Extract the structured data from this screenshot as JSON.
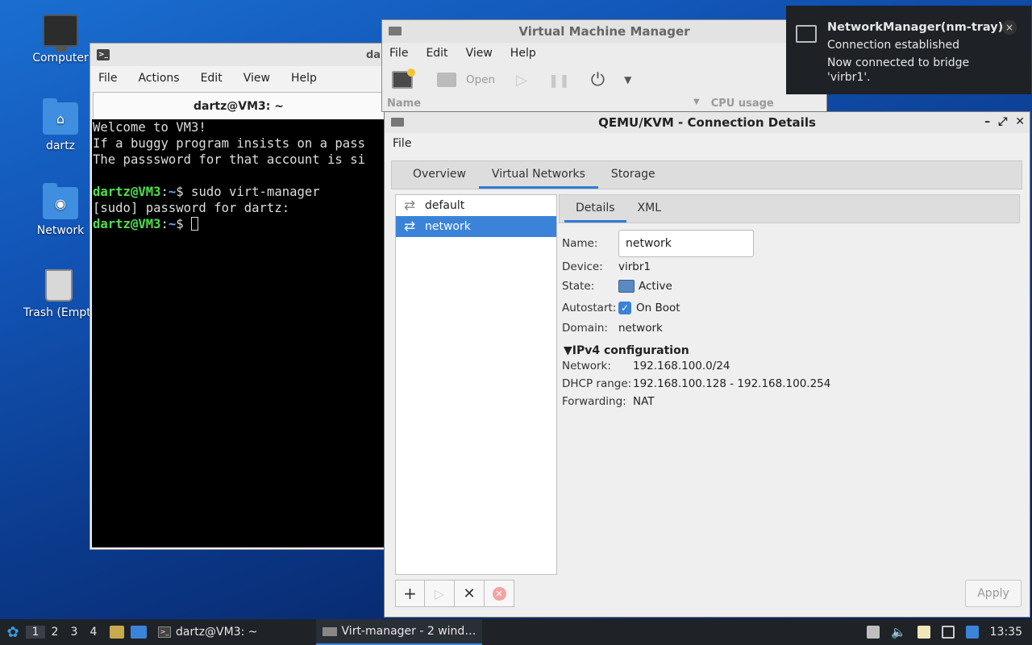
{
  "desktop": {
    "icons": [
      {
        "label": "Computer",
        "icon": "computer-icon"
      },
      {
        "label": "dartz",
        "icon": "home-folder-icon"
      },
      {
        "label": "Network",
        "icon": "network-folder-icon"
      },
      {
        "label": "Trash (Empt",
        "icon": "trash-icon"
      }
    ]
  },
  "terminal": {
    "title_partial": "da",
    "menu": [
      "File",
      "Actions",
      "Edit",
      "View",
      "Help"
    ],
    "tab_title": "dartz@VM3: ~",
    "lines": [
      "Welcome to VM3!",
      "If a buggy program insists on a pass",
      "The passsword for that account is si",
      ""
    ],
    "prompt_user": "dartz@VM3",
    "prompt_sep": ":",
    "prompt_path": "~",
    "prompt_symbol": "$",
    "command": " sudo virt-manager",
    "sudo_line": "[sudo] password for dartz:"
  },
  "vmm": {
    "title": "Virtual Machine Manager",
    "menu": [
      "File",
      "Edit",
      "View",
      "Help"
    ],
    "toolbar": {
      "open": "Open"
    },
    "columns": {
      "name": "Name",
      "cpu": "CPU usage"
    }
  },
  "notification": {
    "title": "NetworkManager(nm-tray)",
    "line1": "Connection established",
    "line2": "Now connected to bridge",
    "line3": "'virbr1'.",
    "close": "×"
  },
  "qemu": {
    "title": "QEMU/KVM - Connection Details",
    "menu_file": "File",
    "tabs": [
      "Overview",
      "Virtual Networks",
      "Storage"
    ],
    "networks": [
      "default",
      "network"
    ],
    "inner_tabs": [
      "Details",
      "XML"
    ],
    "details": {
      "name_label": "Name:",
      "name_value": "network",
      "device_label": "Device:",
      "device_value": "virbr1",
      "state_label": "State:",
      "state_value": "Active",
      "autostart_label": "Autostart:",
      "autostart_value": "On Boot",
      "domain_label": "Domain:",
      "domain_value": "network"
    },
    "ipv4": {
      "title": "IPv4 configuration",
      "network_label": "Network:",
      "network_value": "192.168.100.0/24",
      "dhcp_label": "DHCP range:",
      "dhcp_value": "192.168.100.128 - 192.168.100.254",
      "forwarding_label": "Forwarding:",
      "forwarding_value": "NAT"
    },
    "apply": "Apply"
  },
  "taskbar": {
    "workspaces": [
      "1",
      "2",
      "3",
      "4"
    ],
    "terminal_task": "dartz@VM3: ~",
    "virt_task": "Virt-manager - 2 wind…",
    "clock": "13:35"
  },
  "colors": {
    "accent": "#3a83d9",
    "prompt_green": "#4ee04e",
    "prompt_blue": "#6aa8ff"
  }
}
